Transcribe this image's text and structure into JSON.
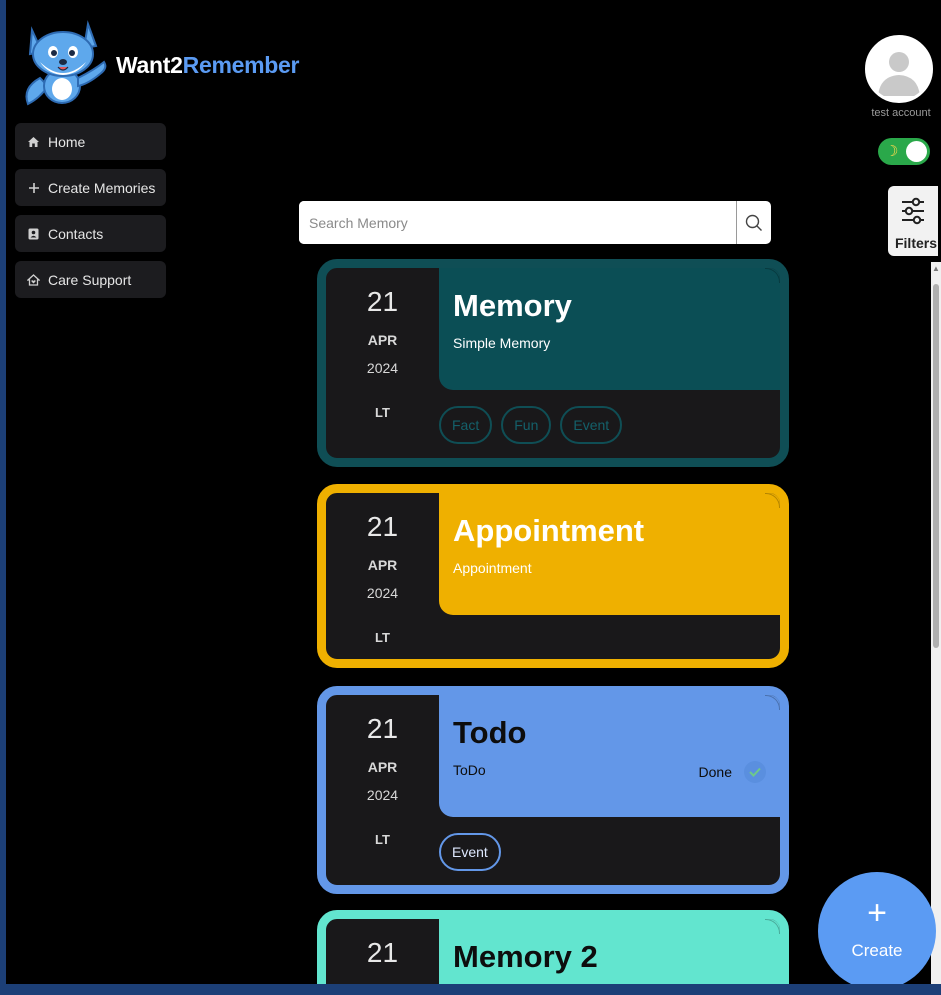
{
  "app": {
    "brand_part1": "Want2",
    "brand_part2": "Remember",
    "brand_color": "#5b9bf3",
    "logo_icon": "fox-mascot-logo"
  },
  "sidebar": {
    "items": [
      {
        "label": "Home",
        "icon": "home-icon"
      },
      {
        "label": "Create Memories",
        "icon": "plus-icon"
      },
      {
        "label": "Contacts",
        "icon": "contact-card-icon"
      },
      {
        "label": "Care Support",
        "icon": "care-house-icon"
      }
    ]
  },
  "account": {
    "label": "test account",
    "theme_toggle": {
      "state": "on",
      "icon": "moon-icon",
      "color": "#2aa84a"
    }
  },
  "filters": {
    "label": "Filters",
    "icon": "sliders-icon"
  },
  "search": {
    "placeholder": "Search Memory",
    "value": "",
    "icon": "search-icon"
  },
  "cards": [
    {
      "day": "21",
      "month": "APR",
      "year": "2024",
      "lt": "LT",
      "title": "Memory",
      "subtitle": "Simple Memory",
      "color": "#0b4e55",
      "tags": [
        "Fact",
        "Fun",
        "Event"
      ]
    },
    {
      "day": "21",
      "month": "APR",
      "year": "2024",
      "lt": "LT",
      "title": "Appointment",
      "subtitle": "Appointment",
      "color": "#efb000",
      "tags": []
    },
    {
      "day": "21",
      "month": "APR",
      "year": "2024",
      "lt": "LT",
      "title": "Todo",
      "subtitle": "ToDo",
      "status": "Done",
      "color": "#6397e8",
      "tags": [
        "Event"
      ]
    },
    {
      "day": "21",
      "title": "Memory 2",
      "color": "#62e5cf"
    }
  ],
  "fab": {
    "label": "Create",
    "icon": "plus-icon"
  }
}
